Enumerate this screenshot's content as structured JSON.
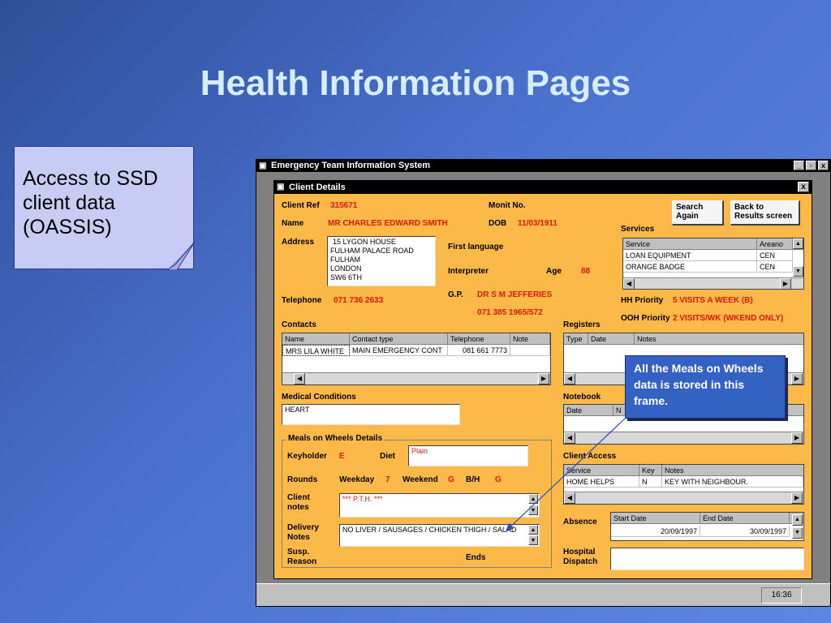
{
  "slide": {
    "title": "Health Information Pages",
    "note": "Access to SSD client data (OASSIS)",
    "callout": "All the Meals on Wheels data is stored in this frame."
  },
  "app": {
    "title": "Emergency Team Information System",
    "window_controls": [
      "_",
      "▫",
      "x"
    ],
    "clock": "16:36"
  },
  "client": {
    "window_title": "Client Details",
    "close": "x",
    "labels": {
      "client_ref": "Client Ref",
      "monit_no": "Monit No.",
      "name": "Name",
      "dob": "DOB",
      "address": "Address",
      "first_language": "First language",
      "interpreter": "Interpreter",
      "age": "Age",
      "telephone": "Telephone",
      "gp": "G.P.",
      "contacts": "Contacts",
      "services": "Services",
      "hh_priority": "HH Priority",
      "ooh_priority": "OOH Priority",
      "registers": "Registers",
      "medical_conditions": "Medical Conditions",
      "notebook": "Notebook",
      "client_access": "Client Access",
      "absence": "Absence",
      "hospital_dispatch_1": "Hospital",
      "hospital_dispatch_2": "Dispatch"
    },
    "values": {
      "client_ref": "315671",
      "name": "MR CHARLES EDWARD SMITH",
      "dob": "11/03/1911",
      "address": [
        "15  LYGON HOUSE",
        "FULHAM PALACE ROAD",
        "FULHAM",
        "LONDON",
        "SW6 6TH"
      ],
      "age": "88",
      "telephone": "071 736 2633",
      "gp_name": "DR S M JEFFERIES",
      "gp_phone": "071 385 1965/572",
      "hh_priority": "5 VISITS A WEEK (B)",
      "ooh_priority": "2 VISITS/WK (WKEND ONLY)",
      "medical_condition": "HEART"
    },
    "buttons": {
      "search_again": [
        "Search",
        "Again"
      ],
      "back": [
        "Back to",
        "Results screen"
      ]
    },
    "contacts": {
      "headers": [
        "Name",
        "Contact type",
        "Telephone",
        "Note"
      ],
      "rows": [
        [
          "MRS LILA WHITE",
          "MAIN EMERGENCY CONT",
          "081 661 7773",
          ""
        ]
      ]
    },
    "services": {
      "headers": [
        "Service",
        "Areano"
      ],
      "rows": [
        [
          "LOAN EQUIPMENT",
          "CEN"
        ],
        [
          "ORANGE BADGE",
          "CEN"
        ]
      ]
    },
    "registers": {
      "headers": [
        "Type",
        "Date",
        "Notes"
      ]
    },
    "notebook": {
      "headers": [
        "Date",
        "N"
      ]
    },
    "client_access": {
      "headers": [
        "Service",
        "Key",
        "Notes"
      ],
      "rows": [
        [
          "HOME HELPS",
          "N",
          "KEY WITH NEIGHBOUR."
        ]
      ]
    },
    "absence": {
      "headers": [
        "Start Date",
        "End Date"
      ],
      "rows": [
        [
          "20/09/1997",
          "30/09/1997"
        ]
      ]
    }
  },
  "meals": {
    "group_title": "Meals on Wheels Details",
    "keyholder_label": "Keyholder",
    "keyholder": "E",
    "diet_label": "Diet",
    "diet": "Plain",
    "rounds_label": "Rounds",
    "weekday_label": "Weekday",
    "weekday": "7",
    "weekend_label": "Weekend",
    "weekend": "G",
    "bh_label": "B/H",
    "bh": "G",
    "client_notes_label": [
      "Client",
      "notes"
    ],
    "client_notes": "*** P.T.H. ***",
    "delivery_notes_label": [
      "Delivery",
      "Notes"
    ],
    "delivery_notes": "NO LIVER / SAUSAGES / CHICKEN THIGH / SALAD",
    "susp_reason_label": [
      "Susp.",
      "Reason"
    ],
    "ends_label": "Ends"
  },
  "colors": {
    "form_bg": "#fcb948",
    "value_red": "#e8160c",
    "callout_bg": "#3461c4",
    "title_color": "#d6ecff"
  }
}
